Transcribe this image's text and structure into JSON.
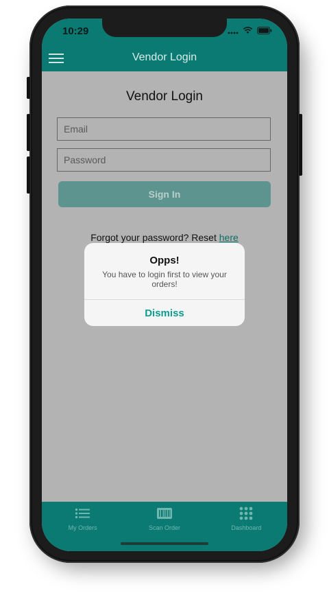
{
  "status_bar": {
    "time": "10:29"
  },
  "header": {
    "title": "Vendor Login",
    "menu_icon": "hamburger-menu-icon"
  },
  "login": {
    "title": "Vendor Login",
    "email_placeholder": "Email",
    "password_placeholder": "Password",
    "sign_in_label": "Sign In",
    "forgot_text": "Forgot your password? Reset ",
    "forgot_link": "here"
  },
  "alert": {
    "title": "Opps!",
    "message": "You have to login first to view your orders!",
    "dismiss_label": "Dismiss"
  },
  "tabbar": {
    "items": [
      {
        "label": "My Orders",
        "icon": "list-icon"
      },
      {
        "label": "Scan Order",
        "icon": "barcode-icon"
      },
      {
        "label": "Dashboard",
        "icon": "grid-icon"
      }
    ]
  },
  "colors": {
    "primary": "#0b7a72",
    "accent": "#0d9b8f",
    "overlay": "#b3b3b3",
    "alert_bg": "#f5f5f5"
  }
}
